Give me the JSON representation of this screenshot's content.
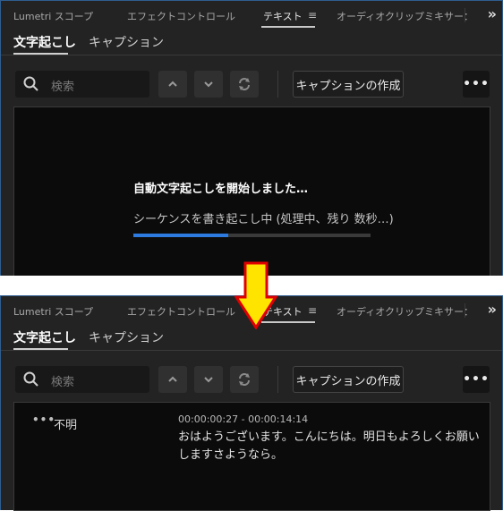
{
  "tabs": [
    "Lumetri スコープ",
    "エフェクトコントロール",
    "テキスト",
    "オーディオクリップミキサー："
  ],
  "subtabs": [
    "文字起こし",
    "キャプション"
  ],
  "search": {
    "placeholder": "検索"
  },
  "create_button": "キャプションの作成",
  "progress": {
    "title": "自動文字起こしを開始しました…",
    "status": "シーケンスを書き起こし中 (処理中、残り 数秒…)",
    "fraction": 0.4
  },
  "transcript": {
    "speaker": "不明",
    "timecode": "00:00:00:27 - 00:00:14:14",
    "text": "おはようございます。こんにちは。明日もよろしくお願いしますさようなら。"
  },
  "colors": {
    "accent": "#2d7be0",
    "arrow_fill": "#ffe400",
    "arrow_stroke": "#e00000"
  },
  "icons": [
    "search-icon",
    "chevron-up-icon",
    "chevron-down-icon",
    "refresh-icon",
    "more-icon",
    "menu-icon",
    "double-chevron-icon",
    "down-arrow-icon"
  ]
}
